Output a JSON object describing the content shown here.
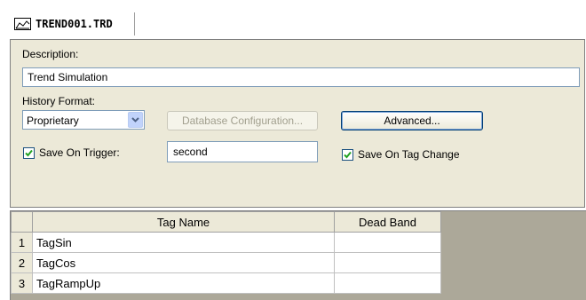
{
  "tab": {
    "icon": "trend-chart-icon",
    "title": "TREND001.TRD"
  },
  "form": {
    "description_label": "Description:",
    "description_value": "Trend Simulation",
    "history_format_label": "History Format:",
    "history_format_value": "Proprietary",
    "database_config_label": "Database Configuration...",
    "advanced_label": "Advanced...",
    "save_on_trigger_label": "Save On Trigger:",
    "save_on_trigger_checked": true,
    "trigger_value": "second",
    "save_on_tag_change_label": "Save On Tag Change",
    "save_on_tag_change_checked": true
  },
  "grid": {
    "columns": [
      "",
      "Tag Name",
      "Dead Band"
    ],
    "rows": [
      {
        "num": "1",
        "tag": "TagSin",
        "deadband": ""
      },
      {
        "num": "2",
        "tag": "TagCos",
        "deadband": ""
      },
      {
        "num": "3",
        "tag": "TagRampUp",
        "deadband": ""
      }
    ]
  },
  "colors": {
    "panel_bg": "#ece9d8",
    "grid_empty_bg": "#aca899",
    "input_border": "#7f9db9",
    "check_mark": "#21a121"
  }
}
